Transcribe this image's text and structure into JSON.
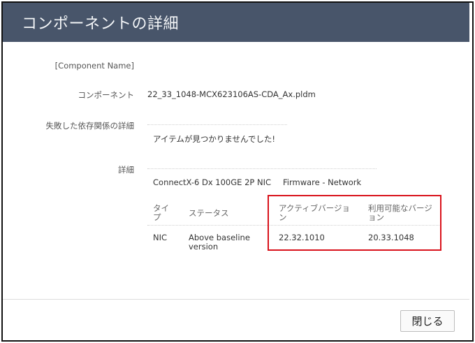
{
  "dialog": {
    "title": "コンポーネントの詳細",
    "close_label": "閉じる"
  },
  "fields": {
    "component_name_label": "[Component Name]",
    "component_label": "コンポーネント",
    "component_value": "22_33_1048-MCX623106AS-CDA_Ax.pldm",
    "failed_deps_label": "失敗した依存関係の詳細",
    "failed_deps_value": "アイテムが見つかりませんでした!",
    "details_label": "詳細"
  },
  "details": {
    "device_name": "ConnectX-6 Dx 100GE 2P NIC",
    "device_category": "Firmware - Network",
    "table": {
      "headers": [
        "タイプ",
        "ステータス",
        "アクティブバージョン",
        "利用可能なバージョン"
      ],
      "rows": [
        [
          "NIC",
          "Above baseline version",
          "22.32.1010",
          "20.33.1048"
        ]
      ]
    }
  },
  "colors": {
    "header_bg": "#48556a",
    "highlight": "#d9121b"
  }
}
